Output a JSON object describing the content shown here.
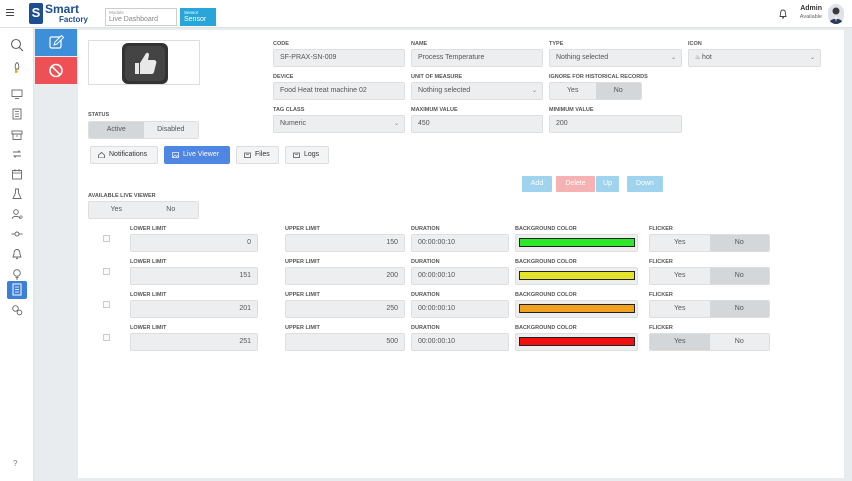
{
  "app": {
    "logo_line1": "Smart",
    "logo_line2": "Factory",
    "logo_mark": "S"
  },
  "breadcrumb": [
    {
      "key": "Module",
      "value": "Live Dashboard"
    },
    {
      "key": "Sensor",
      "value": "Sensor"
    }
  ],
  "user": {
    "name": "Admin",
    "status": "Available"
  },
  "sidebar": {
    "icons": [
      "search-icon",
      "rocket-icon",
      "monitor-icon",
      "building-icon",
      "archive-icon",
      "refresh-icon",
      "calendar-icon",
      "flask-icon",
      "user-settings-icon",
      "connection-icon",
      "bell-icon",
      "lightbulb-icon",
      "document-icon",
      "gears-icon"
    ],
    "help": "?"
  },
  "form": {
    "code": {
      "label": "CODE",
      "value": "SF-PRAX-SN-009"
    },
    "name": {
      "label": "NAME",
      "value": "Process Temperature"
    },
    "type": {
      "label": "TYPE",
      "value": "Nothing selected"
    },
    "icon": {
      "label": "ICON",
      "value": "hot"
    },
    "device": {
      "label": "DEVICE",
      "value": "Food Heat treat machine 02"
    },
    "unit": {
      "label": "UNIT OF MEASURE",
      "value": "Nothing selected"
    },
    "ignore": {
      "label": "IGNORE FOR HISTORICAL RECORDS",
      "yes": "Yes",
      "no": "No"
    },
    "status": {
      "label": "STATUS",
      "active": "Active",
      "disabled": "Disabled"
    },
    "tag_class": {
      "label": "TAG CLASS",
      "value": "Numeric"
    },
    "max": {
      "label": "MAXIMUM VALUE",
      "value": "450"
    },
    "min": {
      "label": "MINIMUM VALUE",
      "value": "200"
    }
  },
  "tabs": [
    "Notifications",
    "Live Viewer",
    "Files",
    "Logs"
  ],
  "table_buttons": {
    "add": "Add",
    "delete": "Delete",
    "up": "Up",
    "down": "Down"
  },
  "live_viewer": {
    "label": "AVAILABLE LIVE VIEWER",
    "yes": "Yes",
    "no": "No"
  },
  "col_labels": {
    "lower": "LOWER LIMIT",
    "upper": "UPPER LIMIT",
    "duration": "DURATION",
    "bg": "BACKGROUND COLOR",
    "flicker": "FLICKER",
    "yes": "Yes",
    "no": "No"
  },
  "rows": [
    {
      "lower": "0",
      "upper": "150",
      "duration": "00:00:00:10",
      "color": "#2ee82a",
      "flicker": "No"
    },
    {
      "lower": "151",
      "upper": "200",
      "duration": "00:00:00:10",
      "color": "#e3e32a",
      "flicker": "No"
    },
    {
      "lower": "201",
      "upper": "250",
      "duration": "00:00:00:10",
      "color": "#f0a21e",
      "flicker": "No"
    },
    {
      "lower": "251",
      "upper": "500",
      "duration": "00:00:00:10",
      "color": "#f01010",
      "flicker": "Yes"
    }
  ]
}
